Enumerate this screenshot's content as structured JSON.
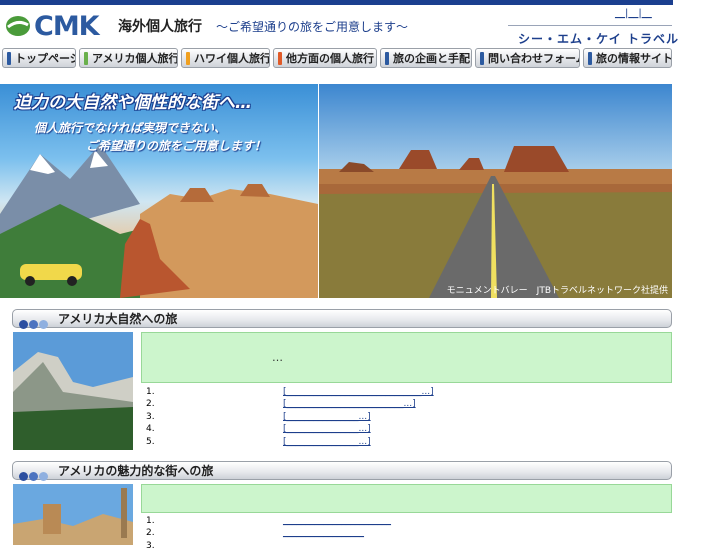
{
  "header": {
    "logo_text": "CMK",
    "title": "海外個人旅行",
    "subtitle": "〜ご希望通りの旅をご用意します〜",
    "top_links": [
      "__",
      "__",
      "__"
    ],
    "brand_name": "シー・エム・ケイ トラベル"
  },
  "nav": {
    "items": [
      {
        "label": "トップページ",
        "color": "#2c5aa0"
      },
      {
        "label": "アメリカ個人旅行",
        "color": "#6ab04c"
      },
      {
        "label": "ハワイ個人旅行",
        "color": "#f0a020"
      },
      {
        "label": "他方面の個人旅行",
        "color": "#e05a28"
      },
      {
        "label": "旅の企画と手配",
        "color": "#2c5aa0"
      },
      {
        "label": "問い合わせフォーム",
        "color": "#2c5aa0"
      },
      {
        "label": "旅の情報サイト",
        "color": "#2c5aa0"
      }
    ]
  },
  "banner": {
    "headline": "迫力の大自然や個性的な街へ…",
    "line1": "個人旅行でなければ実現できない、",
    "line2": "ご希望通りの旅をご用意します！",
    "caption": "モニュメントバレー　JTBトラベルネットワーク社提供"
  },
  "section1": {
    "title": "アメリカ大自然への旅",
    "box_text": "…",
    "items": [
      {
        "num": "1.",
        "link": "[______________________________...]"
      },
      {
        "num": "2.",
        "link": "[__________________________...]"
      },
      {
        "num": "3.",
        "link": "[________________...]"
      },
      {
        "num": "4.",
        "link": "[________________...]"
      },
      {
        "num": "5.",
        "link": "[________________...]"
      }
    ]
  },
  "section2": {
    "title": "アメリカの魅力的な街への旅",
    "items": [
      {
        "num": "1.",
        "link": "________________________"
      },
      {
        "num": "2.",
        "link": "__________________"
      },
      {
        "num": "3.",
        "link": ""
      }
    ]
  },
  "colors": {
    "accent": "#1b3f8f",
    "green_box": "#ccf5cc",
    "dot_dark": "#2c4fa0",
    "dot_light": "#8fb0e0"
  }
}
